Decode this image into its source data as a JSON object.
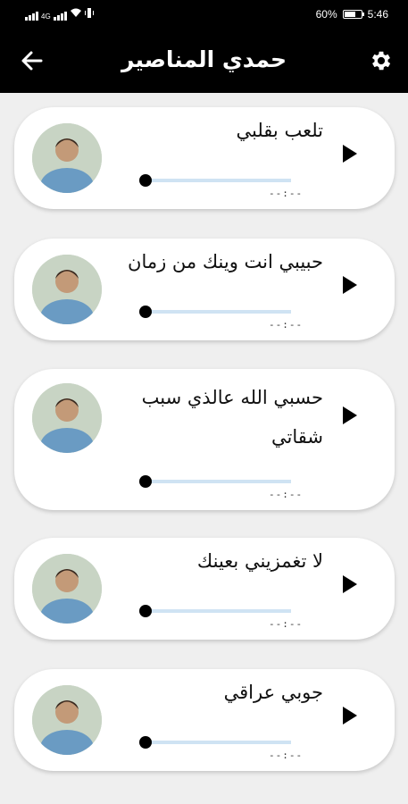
{
  "status_bar": {
    "network_text": "4G",
    "battery_percent": "60%",
    "clock": "5:46"
  },
  "app_bar": {
    "title": "حمدي المناصير",
    "back_icon": "arrow-left-icon",
    "settings_icon": "gear-icon"
  },
  "tracks": [
    {
      "title": "تلعب بقلبي",
      "time": "--:--",
      "progress": 0
    },
    {
      "title": "حبيبي انت وينك من زمان",
      "time": "--:--",
      "progress": 0
    },
    {
      "title": "حسبي الله عالذي سبب شقاتي",
      "time": "--:--",
      "progress": 0
    },
    {
      "title": "لا تغمزيني بعينك",
      "time": "--:--",
      "progress": 0
    },
    {
      "title": "جوبي عراقي",
      "time": "--:--",
      "progress": 0
    }
  ],
  "colors": {
    "app_bar": "#000000",
    "background": "#efefef",
    "card": "#ffffff",
    "seek_track": "#cfe3f3",
    "seek_thumb": "#000000"
  }
}
